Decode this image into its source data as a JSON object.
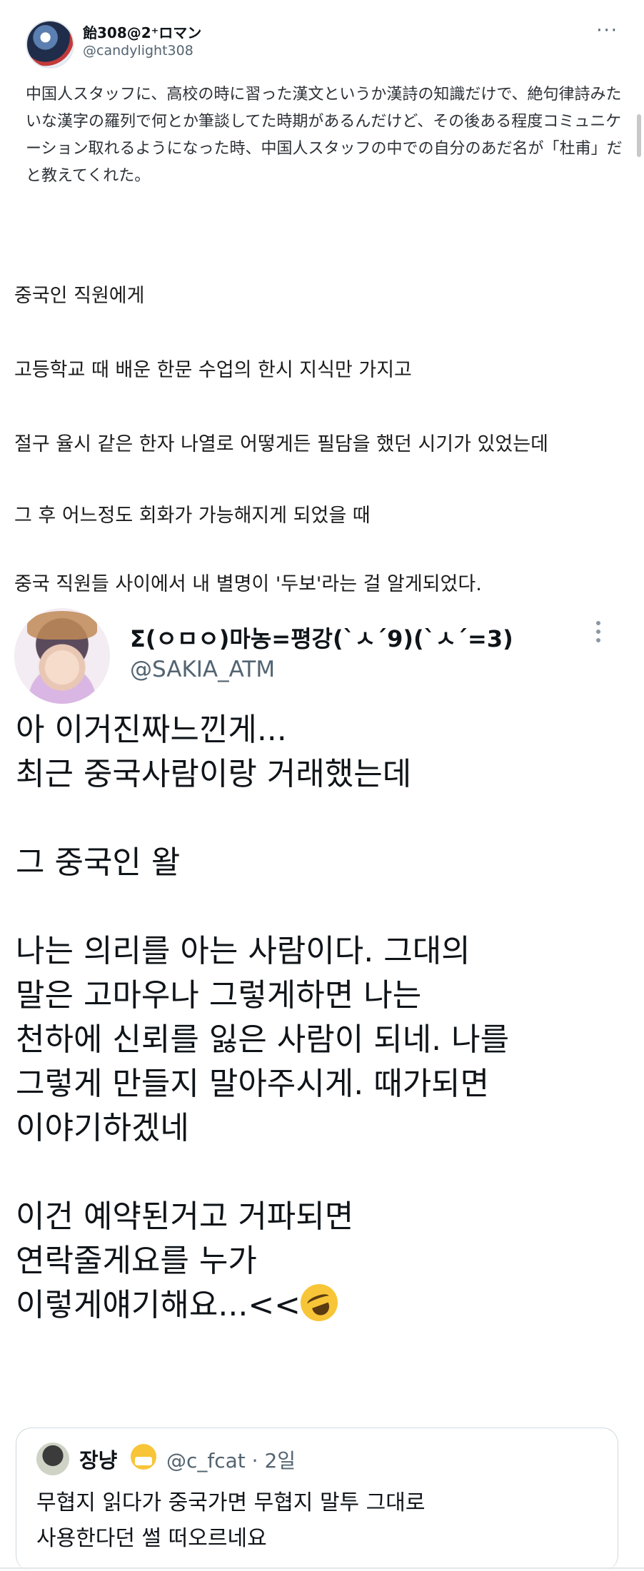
{
  "tweet1": {
    "display_name": "飴308@2⁺ロマン",
    "handle": "@candylight308",
    "more_icon": "ellipsis-icon",
    "japanese_text": "中国人スタッフに、高校の時に習った漢文というか漢詩の知識だけで、絶句律詩みたいな漢字の羅列で何とか筆談してた時期があるんだけど、その後ある程度コミュニケーション取れるようになった時、中国人スタッフの中での自分のあだ名が「杜甫」だと教えてくれた。",
    "korean_translation": [
      "중국인 직원에게",
      "고등학교 때 배운 한문 수업의 한시 지식만 가지고",
      "절구 율시 같은 한자 나열로 어떻게든 필담을 했던 시기가 있었는데",
      "그 후 어느정도 회화가 가능해지게 되었을 때",
      "중국 직원들 사이에서 내 별명이 '두보'라는 걸 알게되었다."
    ]
  },
  "tweet2": {
    "display_name": "Σ(ㅇㅁㅇ)마농=평강(`ㅅ´9)(`ㅅ´=3)",
    "handle": "@SAKIA_ATM",
    "more_icon": "vertical-ellipsis-icon",
    "body_lines": [
      "아 이거진짜느낀게...",
      "최근 중국사람이랑 거래했는데",
      "",
      "그 중국인 왈",
      "",
      "나는 의리를 아는 사람이다. 그대의",
      "말은 고마우나 그렇게하면 나는",
      "천하에 신뢰를 잃은 사람이 되네. 나를",
      "그렇게 만들지 말아주시게. 때가되면",
      "이야기하겠네",
      "",
      "이건 예약된거고 거파되면",
      "연락줄게요를 누가",
      "이렇게얘기해요...<<"
    ],
    "emoji": "rolling-on-floor-laughing-emoji"
  },
  "quote": {
    "display_name": "장냥",
    "name_emoji": "mask-face-emoji",
    "handle_time": "@c_fcat · 2일",
    "body_lines": [
      "무협지 읽다가 중국가면 무협지 말투 그대로",
      "사용한다던 썰 떠오르네요"
    ]
  }
}
